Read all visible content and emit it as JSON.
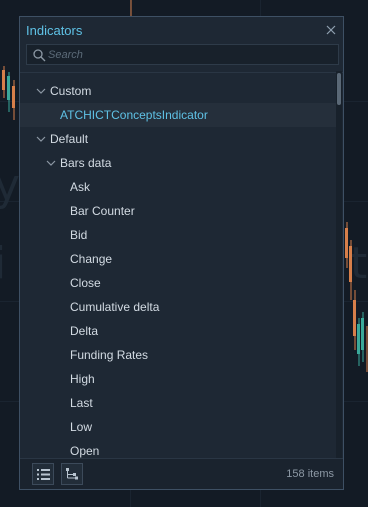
{
  "panel": {
    "title": "Indicators",
    "search_placeholder": "Search",
    "item_count": "158 items"
  },
  "tree": {
    "custom_group": "Custom",
    "custom_item": "ATCHICTConceptsIndicator",
    "default_group": "Default",
    "bars_data_group": "Bars data",
    "bars_data_items": [
      "Ask",
      "Bar Counter",
      "Bid",
      "Change",
      "Close",
      "Cumulative delta",
      "Delta",
      "Funding Rates",
      "High",
      "Last",
      "Low",
      "Open"
    ]
  },
  "colors": {
    "accent": "#5fc2e6",
    "panel_bg": "#1e2834",
    "text": "#d3dbe3"
  },
  "icons": {
    "close": "close-icon",
    "search": "search-icon",
    "list_view": "list-view-icon",
    "tree_view": "tree-view-icon"
  }
}
